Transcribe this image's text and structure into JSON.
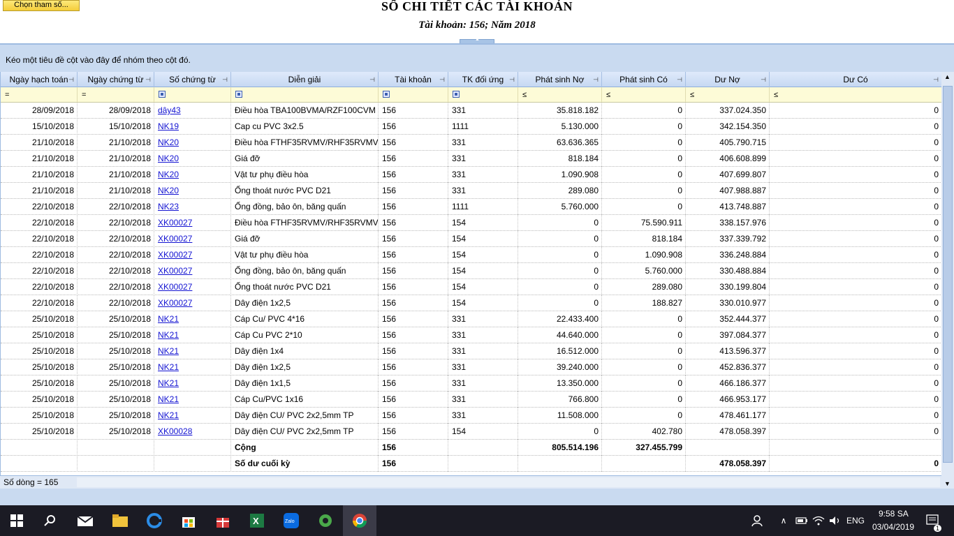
{
  "header": {
    "choose_button": "Chọn tham số...",
    "title": "SỔ CHI TIẾT CÁC TÀI KHOẢN",
    "subtitle": "Tài khoản: 156; Năm 2018"
  },
  "group_panel_text": "Kéo một tiêu đề cột vào đây để nhóm theo cột đó.",
  "columns": [
    "Ngày hạch toán",
    "Ngày chứng từ",
    "Số chứng từ",
    "Diễn giải",
    "Tài khoản",
    "TK đối ứng",
    "Phát sinh Nợ",
    "Phát sinh Có",
    "Dư Nợ",
    "Dư Có"
  ],
  "filter_ops": [
    "=",
    "=",
    "■",
    "■",
    "■",
    "■",
    "≤",
    "≤",
    "≤",
    "≤"
  ],
  "rows": [
    [
      "28/09/2018",
      "28/09/2018",
      "dây43",
      "Điều hòa TBA100BVMA/RZF100CVM",
      "156",
      "331",
      "35.818.182",
      "0",
      "337.024.350",
      "0"
    ],
    [
      "15/10/2018",
      "15/10/2018",
      "NK19",
      "Cap cu PVC 3x2.5",
      "156",
      "1111",
      "5.130.000",
      "0",
      "342.154.350",
      "0"
    ],
    [
      "21/10/2018",
      "21/10/2018",
      "NK20",
      "Điều hòa FTHF35RVMV/RHF35RVMV",
      "156",
      "331",
      "63.636.365",
      "0",
      "405.790.715",
      "0"
    ],
    [
      "21/10/2018",
      "21/10/2018",
      "NK20",
      "Giá đỡ",
      "156",
      "331",
      "818.184",
      "0",
      "406.608.899",
      "0"
    ],
    [
      "21/10/2018",
      "21/10/2018",
      "NK20",
      "Vật tư phụ điều hòa",
      "156",
      "331",
      "1.090.908",
      "0",
      "407.699.807",
      "0"
    ],
    [
      "21/10/2018",
      "21/10/2018",
      "NK20",
      "Ống thoát nước PVC D21",
      "156",
      "331",
      "289.080",
      "0",
      "407.988.887",
      "0"
    ],
    [
      "22/10/2018",
      "22/10/2018",
      "NK23",
      "Ống đồng, bảo ôn, băng quấn",
      "156",
      "1111",
      "5.760.000",
      "0",
      "413.748.887",
      "0"
    ],
    [
      "22/10/2018",
      "22/10/2018",
      "XK00027",
      "Điều hòa FTHF35RVMV/RHF35RVMV",
      "156",
      "154",
      "0",
      "75.590.911",
      "338.157.976",
      "0"
    ],
    [
      "22/10/2018",
      "22/10/2018",
      "XK00027",
      "Giá đỡ",
      "156",
      "154",
      "0",
      "818.184",
      "337.339.792",
      "0"
    ],
    [
      "22/10/2018",
      "22/10/2018",
      "XK00027",
      "Vật tư phụ điều hòa",
      "156",
      "154",
      "0",
      "1.090.908",
      "336.248.884",
      "0"
    ],
    [
      "22/10/2018",
      "22/10/2018",
      "XK00027",
      "Ống đồng, bảo ôn, băng quấn",
      "156",
      "154",
      "0",
      "5.760.000",
      "330.488.884",
      "0"
    ],
    [
      "22/10/2018",
      "22/10/2018",
      "XK00027",
      "Ống thoát nước PVC D21",
      "156",
      "154",
      "0",
      "289.080",
      "330.199.804",
      "0"
    ],
    [
      "22/10/2018",
      "22/10/2018",
      "XK00027",
      "Dây điện 1x2,5",
      "156",
      "154",
      "0",
      "188.827",
      "330.010.977",
      "0"
    ],
    [
      "25/10/2018",
      "25/10/2018",
      "NK21",
      "Cáp Cu/ PVC 4*16",
      "156",
      "331",
      "22.433.400",
      "0",
      "352.444.377",
      "0"
    ],
    [
      "25/10/2018",
      "25/10/2018",
      "NK21",
      "Cáp Cu PVC 2*10",
      "156",
      "331",
      "44.640.000",
      "0",
      "397.084.377",
      "0"
    ],
    [
      "25/10/2018",
      "25/10/2018",
      "NK21",
      "Dây điện 1x4",
      "156",
      "331",
      "16.512.000",
      "0",
      "413.596.377",
      "0"
    ],
    [
      "25/10/2018",
      "25/10/2018",
      "NK21",
      "Dây điện 1x2,5",
      "156",
      "331",
      "39.240.000",
      "0",
      "452.836.377",
      "0"
    ],
    [
      "25/10/2018",
      "25/10/2018",
      "NK21",
      "Dây điện 1x1,5",
      "156",
      "331",
      "13.350.000",
      "0",
      "466.186.377",
      "0"
    ],
    [
      "25/10/2018",
      "25/10/2018",
      "NK21",
      "Cáp Cu/PVC 1x16",
      "156",
      "331",
      "766.800",
      "0",
      "466.953.177",
      "0"
    ],
    [
      "25/10/2018",
      "25/10/2018",
      "NK21",
      "Dây điện CU/ PVC 2x2,5mm TP",
      "156",
      "331",
      "11.508.000",
      "0",
      "478.461.177",
      "0"
    ],
    [
      "25/10/2018",
      "25/10/2018",
      "XK00028",
      "Dây điện CU/ PVC 2x2,5mm TP",
      "156",
      "154",
      "0",
      "402.780",
      "478.058.397",
      "0"
    ]
  ],
  "total_row": {
    "label": "Cộng",
    "account": "156",
    "debit": "805.514.196",
    "credit": "327.455.799"
  },
  "closing_row": {
    "label": "Số dư cuối kỳ",
    "account": "156",
    "debit_balance": "478.058.397",
    "credit_balance": "0"
  },
  "status": "Số dòng = 165",
  "taskbar": {
    "language": "ENG",
    "time": "9:58 SA",
    "date": "03/04/2019",
    "notification_count": "1"
  }
}
